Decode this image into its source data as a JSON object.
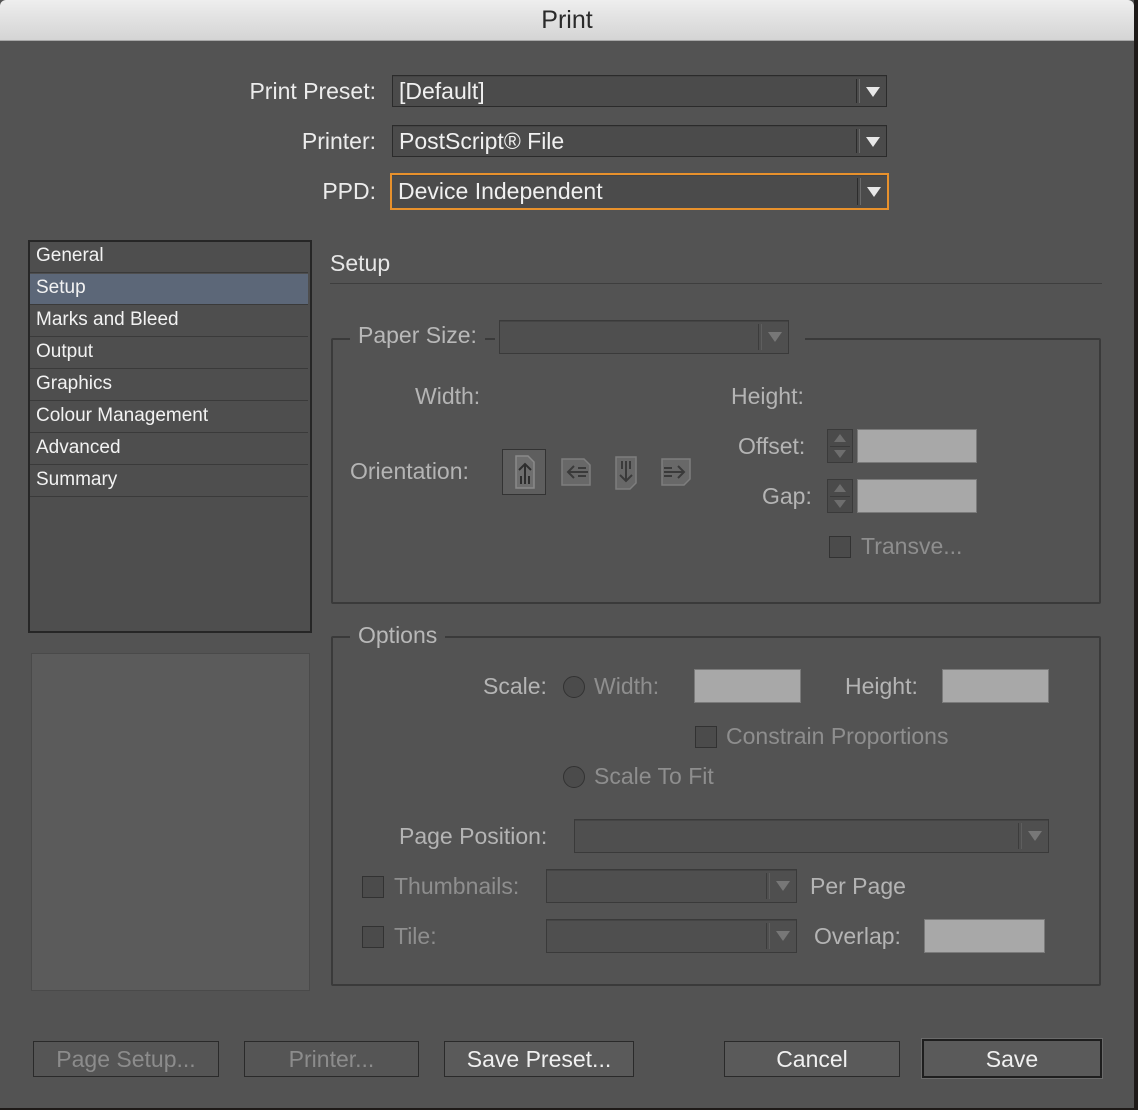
{
  "window": {
    "title": "Print"
  },
  "header": {
    "preset_label": "Print Preset:",
    "preset_value": "[Default]",
    "printer_label": "Printer:",
    "printer_value": "PostScript® File",
    "ppd_label": "PPD:",
    "ppd_value": "Device Independent"
  },
  "categories": [
    "General",
    "Setup",
    "Marks and Bleed",
    "Output",
    "Graphics",
    "Colour Management",
    "Advanced",
    "Summary"
  ],
  "selected_category": "Setup",
  "panel": {
    "title": "Setup"
  },
  "paper": {
    "label": "Paper Size:",
    "value": "",
    "width_label": "Width:",
    "height_label": "Height:",
    "offset_label": "Offset:",
    "gap_label": "Gap:",
    "orientation_label": "Orientation:",
    "orientation_options": [
      "portrait",
      "landscape",
      "reverse-portrait",
      "reverse-landscape"
    ],
    "transverse_label": "Transve..."
  },
  "options": {
    "legend": "Options",
    "scale_label": "Scale:",
    "width_label": "Width:",
    "height_label": "Height:",
    "constrain_label": "Constrain Proportions",
    "scale_to_fit_label": "Scale To Fit",
    "page_position_label": "Page Position:",
    "thumbnails_label": "Thumbnails:",
    "per_page_label": "Per Page",
    "tile_label": "Tile:",
    "overlap_label": "Overlap:"
  },
  "buttons": {
    "page_setup": "Page Setup...",
    "printer": "Printer...",
    "save_preset": "Save Preset...",
    "cancel": "Cancel",
    "save": "Save"
  },
  "colors": {
    "focus": "#e8912c",
    "selection": "#5c6778",
    "background": "#535353"
  }
}
